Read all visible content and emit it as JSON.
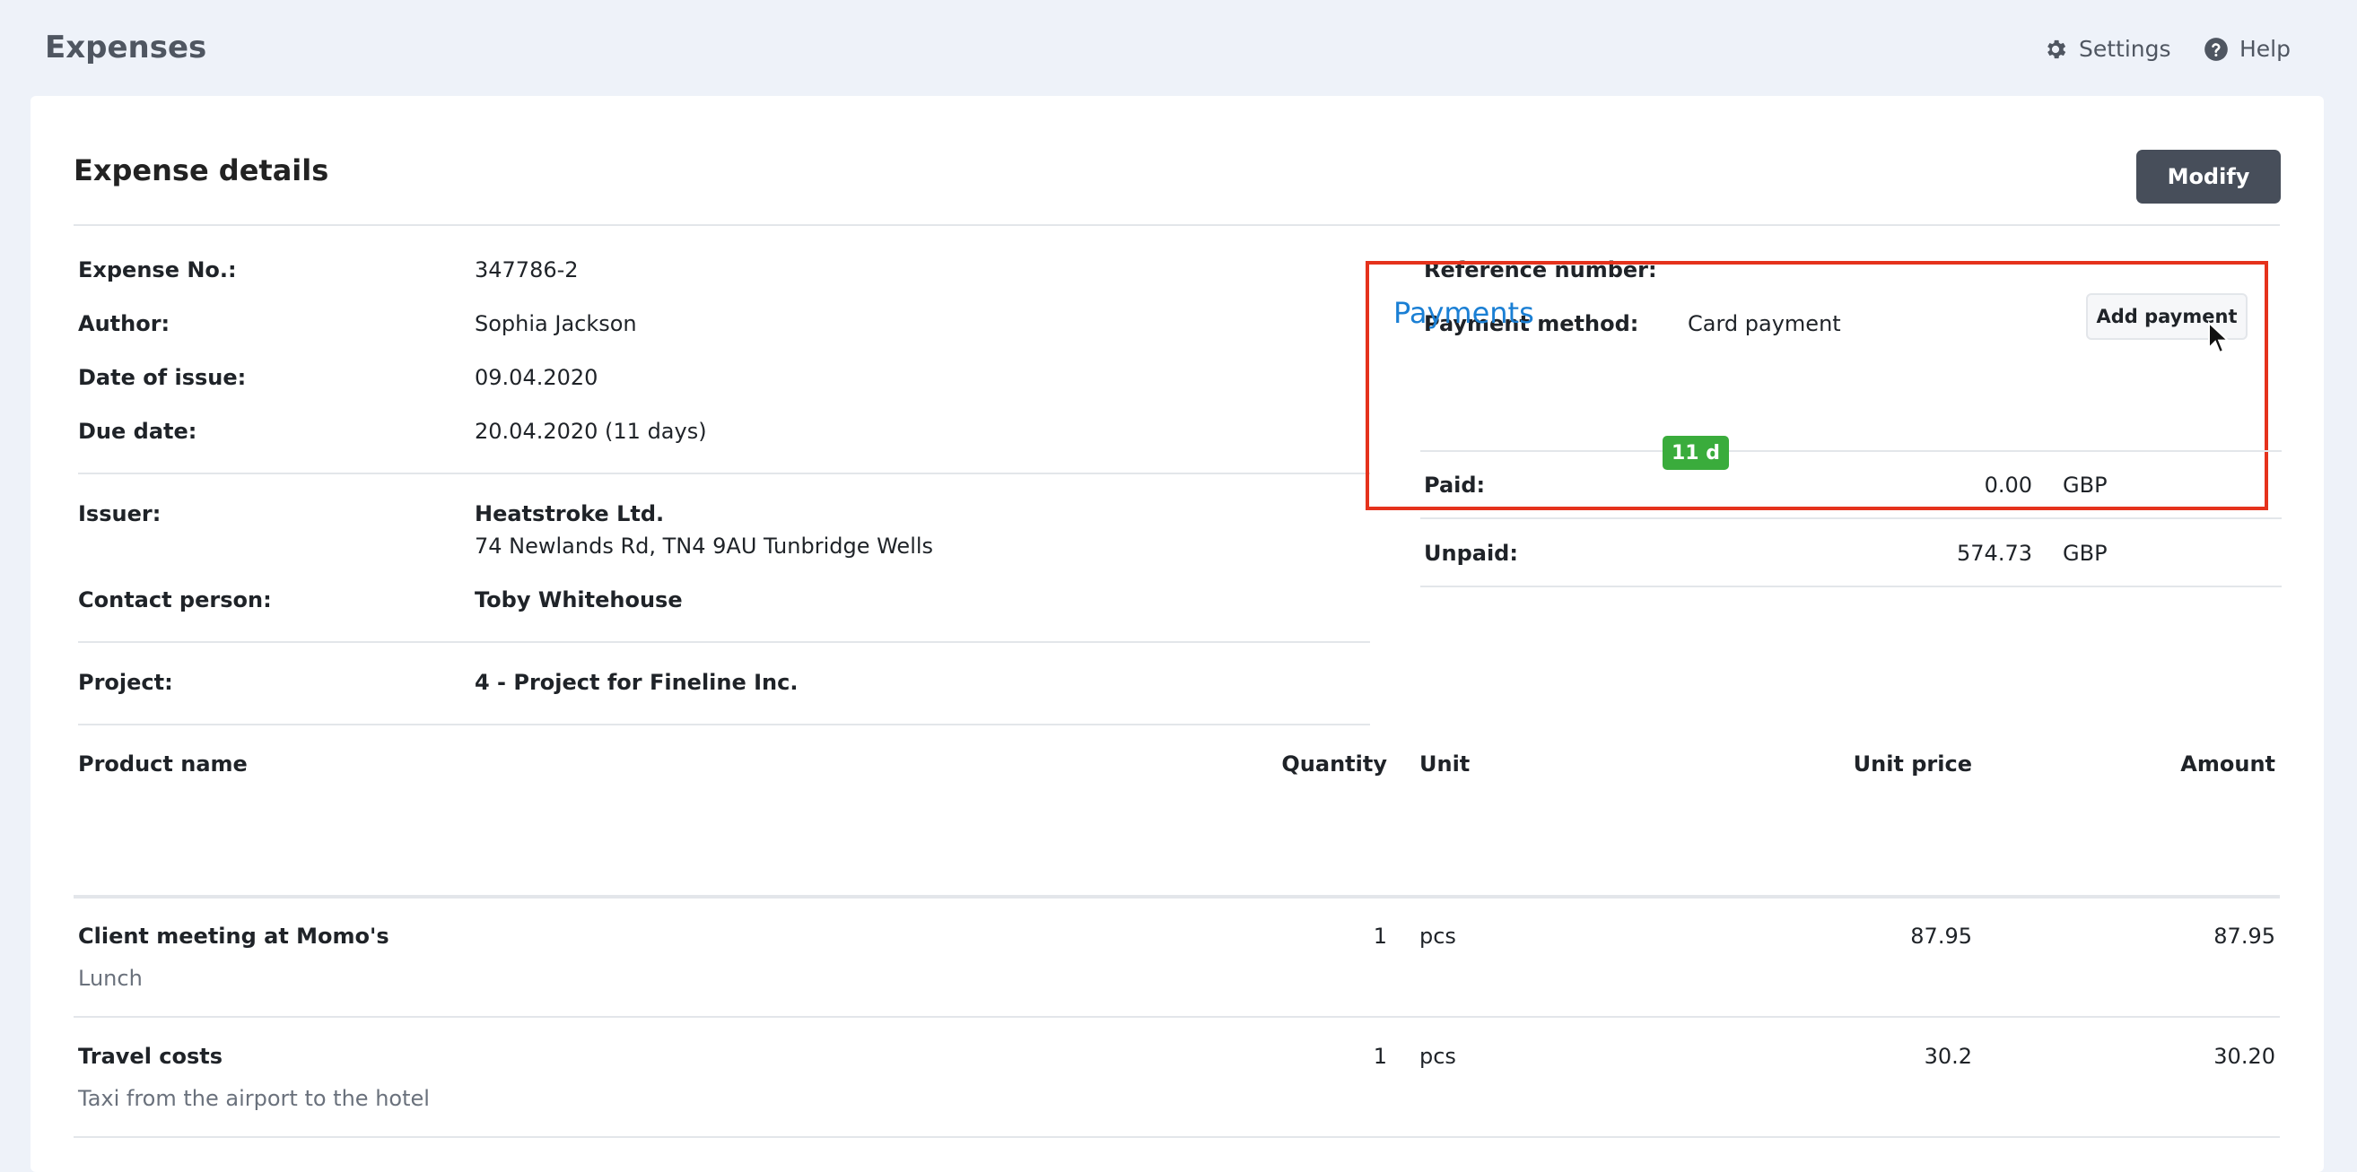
{
  "header": {
    "app_title": "Expenses",
    "settings_label": "Settings",
    "help_label": "Help"
  },
  "card": {
    "title": "Expense details",
    "modify_label": "Modify"
  },
  "details": {
    "expense_no_label": "Expense No.:",
    "expense_no": "347786-2",
    "author_label": "Author:",
    "author": "Sophia Jackson",
    "date_of_issue_label": "Date of issue:",
    "date_of_issue": "09.04.2020",
    "due_date_label": "Due date:",
    "due_date": "20.04.2020 (11 days)",
    "issuer_label": "Issuer:",
    "issuer_name": "Heatstroke Ltd.",
    "issuer_address": "74 Newlands Rd, TN4 9AU Tunbridge Wells",
    "contact_label": "Contact person:",
    "contact": "Toby Whitehouse",
    "project_label": "Project:",
    "project": "4 - Project for Fineline Inc.",
    "reference_label": "Reference number:",
    "reference": "",
    "payment_method_label": "Payment method:",
    "payment_method": "Card payment"
  },
  "payments": {
    "title": "Payments",
    "add_label": "Add payment",
    "paid_label": "Paid:",
    "paid_amount": "0.00",
    "paid_currency": "GBP",
    "unpaid_label": "Unpaid:",
    "unpaid_badge": "11 d",
    "unpaid_amount": "574.73",
    "unpaid_currency": "GBP"
  },
  "items_table": {
    "headers": {
      "product": "Product name",
      "quantity": "Quantity",
      "unit": "Unit",
      "unit_price": "Unit price",
      "amount": "Amount"
    },
    "rows": [
      {
        "name": "Client meeting at Momo's",
        "description": "Lunch",
        "quantity": "1",
        "unit": "pcs",
        "unit_price": "87.95",
        "amount": "87.95"
      },
      {
        "name": "Travel costs",
        "description": "Taxi from the airport to the hotel",
        "quantity": "1",
        "unit": "pcs",
        "unit_price": "30.2",
        "amount": "30.20"
      }
    ]
  },
  "colors": {
    "accent_blue": "#1a7fd4",
    "highlight_red": "#e5321c",
    "badge_green": "#3aac3c",
    "modify_button": "#474e5a"
  }
}
